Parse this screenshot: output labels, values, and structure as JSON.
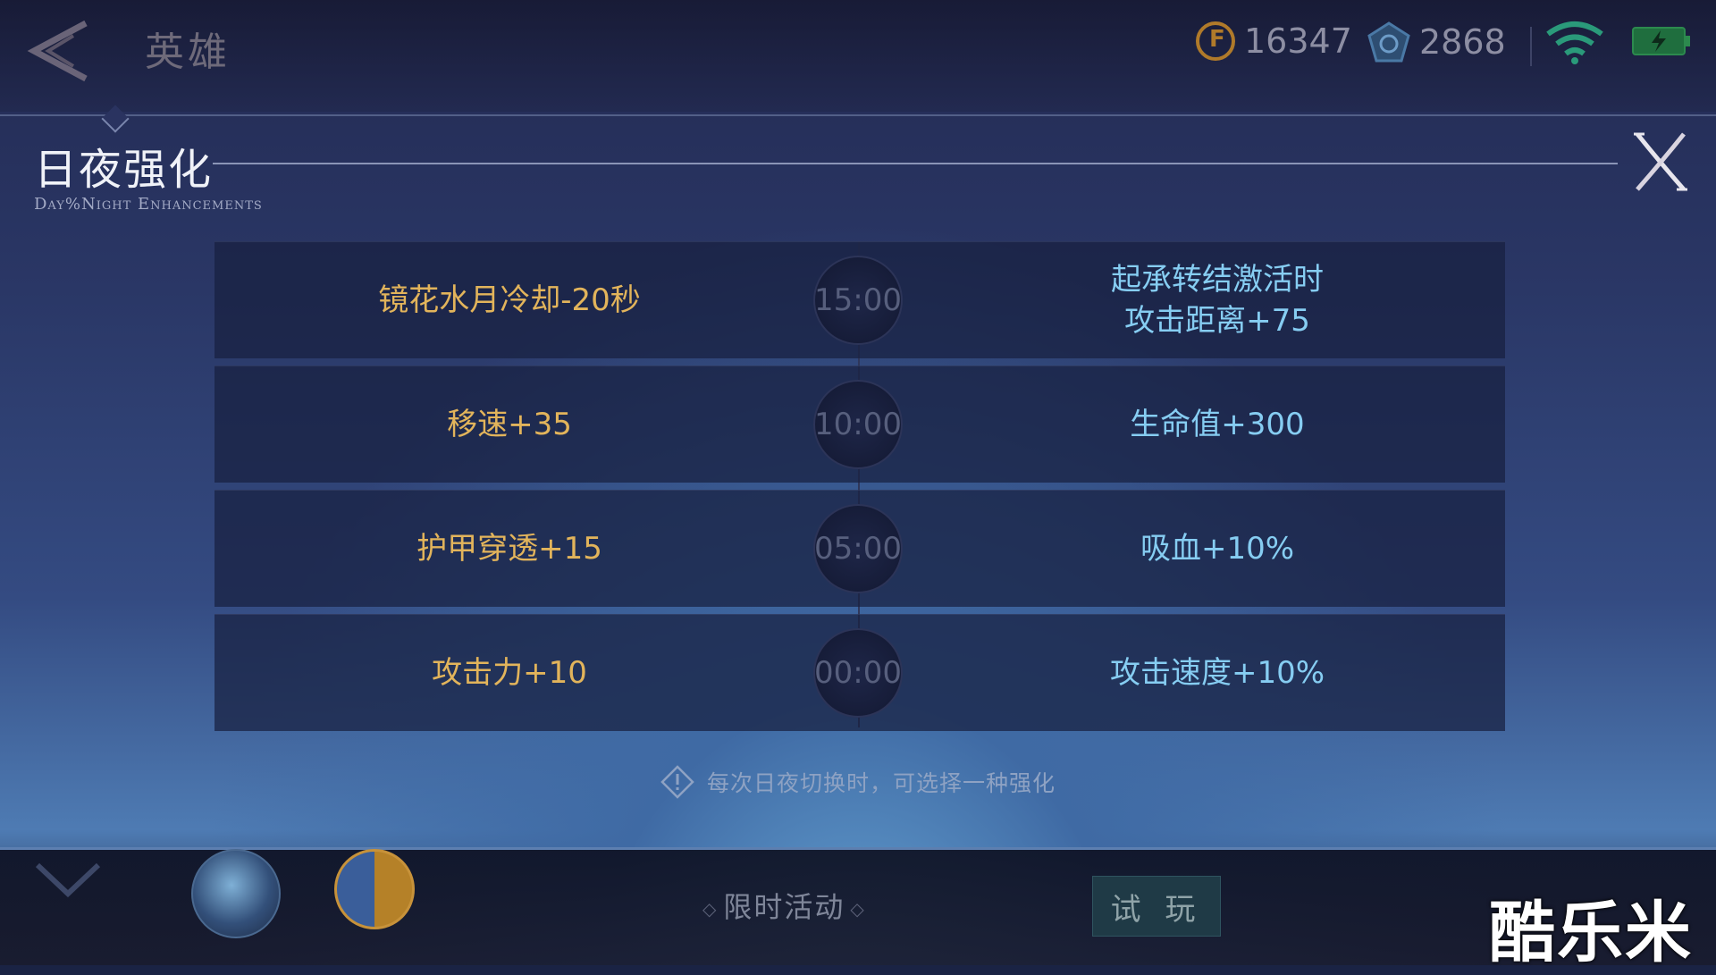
{
  "topbar": {
    "title": "英雄",
    "gold_amount": "16347",
    "gem_amount": "2868"
  },
  "panel": {
    "title": "日夜强化",
    "subtitle": "Day%Night Enhancements",
    "rows": [
      {
        "left": "镜花水月冷却-20秒",
        "time": "15:00",
        "right": "起承转结激活时\n攻击距离+75"
      },
      {
        "left": "移速+35",
        "time": "10:00",
        "right": "生命值+300"
      },
      {
        "left": "护甲穿透+15",
        "time": "05:00",
        "right": "吸血+10%"
      },
      {
        "left": "攻击力+10",
        "time": "00:00",
        "right": "攻击速度+10%"
      }
    ],
    "hint": "每次日夜切换时，可选择一种强化"
  },
  "bottombar": {
    "limited_event_label": "限时活动",
    "trial_button_label": "试 玩"
  },
  "watermark": "酷乐米",
  "colors": {
    "day_text": "#e2b45b",
    "night_text": "#86cdf2",
    "row_background": "#182040"
  },
  "icons": [
    "back-arrow-icon",
    "gold-coin-icon",
    "gem-icon",
    "wifi-icon",
    "battery-charging-icon",
    "close-icon",
    "info-diamond-icon",
    "chevron-down-icon"
  ]
}
